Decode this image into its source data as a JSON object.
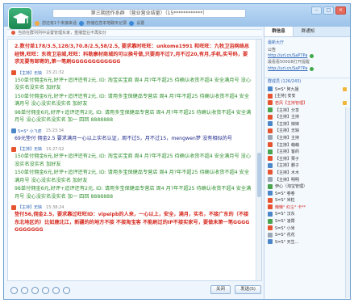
{
  "window": {
    "title": "第三期团作系群 （营业营业结量）（15************）",
    "controls": [
      "–",
      "□",
      "×"
    ]
  },
  "subbar": {
    "items": [
      "您还有1个未接来话",
      "存储在您本地聊天记录",
      "设置"
    ]
  },
  "ad_bar": {
    "text": "当前在群列列中设置管理东家，重播营业不再扣分"
  },
  "messages": [
    {
      "sender": "",
      "time": "",
      "lines": [
        {
          "text": "2.数付单178/3.5,128/3,70.8/2.5,58/2.5, 要求靠时旺旺：unkome1991 和旺旺：九牧卫浴网络总经销,旺旺：东荷卫浴城,旺旺：科勒康材商城的可以换号做,只要周不过7,月不过20,有月,手机,实号码，要求无要有邮寄的,第一笔刷GGGGGGGGGGGG",
          "color": "red",
          "bold": true
        }
      ]
    },
    {
      "sender": "【主持】无缺",
      "time": "15:21:32",
      "lines": [
        {
          "text": "150单付佣金6元,好评+追评还有2元, ID: 淘宝买宝商 周4 月?年不超25 待确认收货不超4 安全满月号 没心没实名没实名 加好友",
          "color": "green"
        },
        {
          "text": "150单付佣金6元,好评+追评还有2元, ID: 请用多宝保健品专营店 周4 月?年不超25 待确认收货不超4 安全满月号 没心没实名没实名 加好友",
          "color": "green"
        },
        {
          "text": "98单付佣金6元,好评+追评还有2元, ID: 请用多宝保健品专营店 周4 月?年不超25 待确认收货不超4 安全满月号 没心没实名没实名 加一 四回 8888888",
          "color": "green"
        }
      ]
    },
    {
      "sender": "S=S° 小飞虎",
      "time": "15:23:34",
      "lines": [
        {
          "text": "69元垫付 佣金2.5 要求满月一心以上实名认证，周不过5，月不过15，mengwen梦  没有相似的号",
          "color": "navy"
        }
      ]
    },
    {
      "sender": "【主持】无缺",
      "time": "15:27:52",
      "lines": [
        {
          "text": "150单付佣金6元,好评+追评还有2元, ID: 淘宝买宝商 周4 月?年不超25 待确认收货不超4 安全满月号 没心没实名没实名 加好友",
          "color": "green"
        },
        {
          "text": "150单付佣金6元,好评+追评还有2元, ID: 请用多宝保健品专营店 周4 月?年不超25 待确认收货不超4 安全满月号 没心没实名没实名 加好友",
          "color": "green"
        },
        {
          "text": "98单付佣金6元,好评+追评还有2元, ID: 请用多宝保健品专营店 周4 月?年不超25 待确认收货不超4 安全满月号 没心没实名没实名 加一 四回 8888888",
          "color": "green"
        }
      ]
    },
    {
      "sender": "【主持】无缺",
      "time": "15:38:24",
      "lines": [
        {
          "text": "垫付56,佣金2.5，要求靠过旺旺ID：vipeipb的人来，一心以上，安全，满月，实名，不接广东的（不接东北地区的）比如鹿北江，新疆的的地方不接 不接淘宝客 不能刷过的IP不接实家号，要做未第一笔GGGGGGGGGGG",
          "color": "red",
          "bold": true
        }
      ]
    }
  ],
  "input_bar": {
    "close_label": "关闭",
    "send_label": "发送(S)"
  },
  "side": {
    "tabs": [
      "群信息",
      "群通知"
    ],
    "notice_label": "最新大厅",
    "notice_sub": "公告",
    "links": [
      "http://url.cn/SaP7Pa",
      "http://url.cn/SaP7Pa"
    ],
    "info": "最看看500GB打开提醒",
    "members_title": "群成员 (126/243)",
    "members": [
      "S=S° 阿九姐",
      "[主持] 安安",
      "若风【主持管理】",
      "【主持】分享",
      "【主持】主持",
      "【主持】妹妹",
      "【主持】无缺",
      "【主持】主持",
      "【主持】萌萌",
      "【主持】客的",
      "【主持】栗子",
      "【主持】鹏子",
      "【主持】木木",
      "【主持】明明",
      "伊心（淘宝管理）",
      "S=S° 卷卷",
      "S=S° 米粒",
      "懒懒° 红尘° 卡**",
      "S=S° 汉东",
      "S=S° 凌霄",
      "S=S° 小米",
      "S=S° 花花",
      "S=S° 天生..."
    ]
  }
}
